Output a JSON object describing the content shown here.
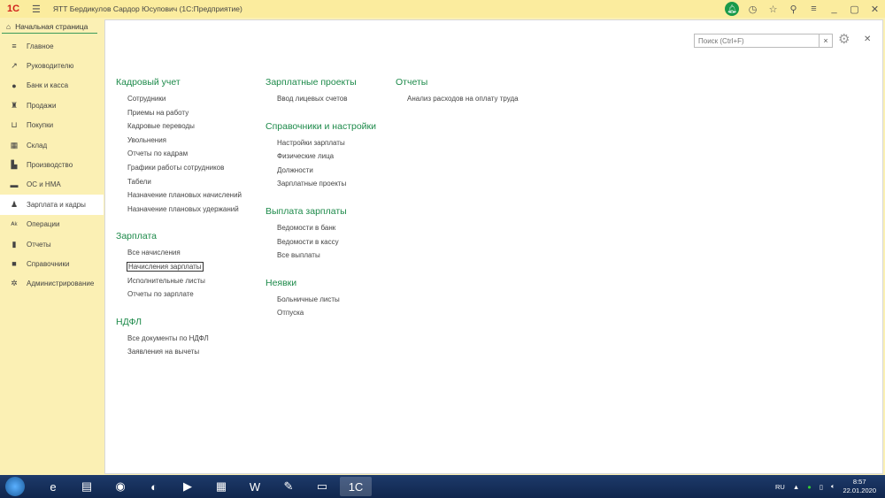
{
  "titlebar": {
    "logo": "1С",
    "title": "ЯТТ Бердикулов Сардор Юсупович  (1С:Предприятие)",
    "icons": [
      "bell-icon",
      "history-icon",
      "star-icon",
      "search-icon",
      "menu-icon",
      "minimize-icon",
      "maximize-icon",
      "close-icon"
    ]
  },
  "home_tab": {
    "label": "Начальная страница"
  },
  "sidebar": {
    "items": [
      {
        "label": "Главное",
        "icon": "≡"
      },
      {
        "label": "Руководителю",
        "icon": "↗"
      },
      {
        "label": "Банк и касса",
        "icon": "●"
      },
      {
        "label": "Продажи",
        "icon": "♜"
      },
      {
        "label": "Покупки",
        "icon": "⊔"
      },
      {
        "label": "Склад",
        "icon": "▦"
      },
      {
        "label": "Производство",
        "icon": "▙"
      },
      {
        "label": "ОС и НМА",
        "icon": "▬"
      },
      {
        "label": "Зарплата и кадры",
        "icon": "♟",
        "active": true
      },
      {
        "label": "Операции",
        "icon": "ᴬᵏ"
      },
      {
        "label": "Отчеты",
        "icon": "▮"
      },
      {
        "label": "Справочники",
        "icon": "■"
      },
      {
        "label": "Администрирование",
        "icon": "✲"
      }
    ]
  },
  "search": {
    "placeholder": "Поиск (Ctrl+F)"
  },
  "groups": [
    {
      "title": "Кадровый учет",
      "col": 0,
      "items": [
        "Сотрудники",
        "Приемы на работу",
        "Кадровые переводы",
        "Увольнения",
        "Отчеты по кадрам",
        "Графики работы сотрудников",
        "Табели",
        "Назначение плановых начислений",
        "Назначение плановых удержаний"
      ]
    },
    {
      "title": "Зарплата",
      "col": 0,
      "items": [
        "Все начисления",
        "Начисления зарплаты",
        "Исполнительные листы",
        "Отчеты по зарплате"
      ],
      "focused": 1
    },
    {
      "title": "НДФЛ",
      "col": 0,
      "items": [
        "Все документы по НДФЛ",
        "Заявления на вычеты"
      ]
    },
    {
      "title": "Зарплатные проекты",
      "col": 1,
      "items": [
        "Ввод лицевых счетов"
      ]
    },
    {
      "title": "Справочники и настройки",
      "col": 1,
      "items": [
        "Настройки зарплаты",
        "Физические лица",
        "Должности",
        "Зарплатные проекты"
      ]
    },
    {
      "title": "Выплата зарплаты",
      "col": 1,
      "items": [
        "Ведомости в банк",
        "Ведомости в кассу",
        "Все выплаты"
      ]
    },
    {
      "title": "Неявки",
      "col": 1,
      "items": [
        "Больничные листы",
        "Отпуска"
      ]
    },
    {
      "title": "Отчеты",
      "col": 2,
      "items": [
        "Анализ расходов на оплату труда"
      ]
    }
  ],
  "taskbar": {
    "apps": [
      "ie",
      "explorer",
      "chrome",
      "firefox",
      "media",
      "calculator",
      "word",
      "notepad",
      "folder",
      "1c"
    ],
    "lang": "RU",
    "time": "8:57",
    "date": "22.01.2020"
  }
}
